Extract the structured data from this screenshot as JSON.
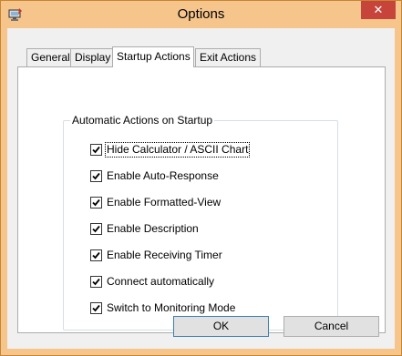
{
  "window": {
    "title": "Options",
    "close_glyph": "✕",
    "title_bar_color": "#f6c58c"
  },
  "tabs": [
    {
      "label": "General",
      "active": false
    },
    {
      "label": "Display",
      "active": false
    },
    {
      "label": "Startup Actions",
      "active": true
    },
    {
      "label": "Exit Actions",
      "active": false
    }
  ],
  "group": {
    "title": "Automatic Actions on Startup",
    "items": [
      {
        "label": "Hide Calculator / ASCII Chart",
        "checked": true
      },
      {
        "label": "Enable Auto-Response",
        "checked": true
      },
      {
        "label": "Enable Formatted-View",
        "checked": true
      },
      {
        "label": "Enable Description",
        "checked": true
      },
      {
        "label": "Enable Receiving Timer",
        "checked": true
      },
      {
        "label": "Connect automatically",
        "checked": true
      },
      {
        "label": "Switch to Monitoring Mode",
        "checked": true
      }
    ]
  },
  "buttons": {
    "ok": "OK",
    "cancel": "Cancel"
  }
}
